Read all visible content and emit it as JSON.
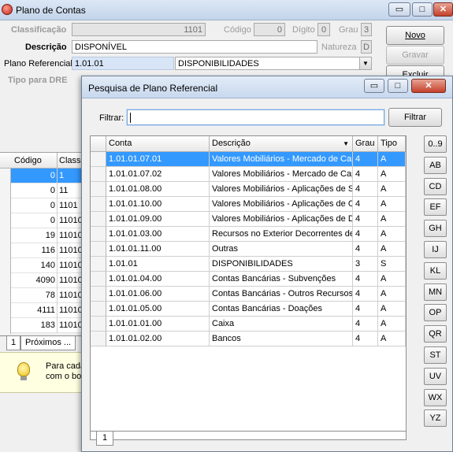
{
  "main_window": {
    "title": "Plano de Contas",
    "win_buttons": [
      "▭",
      "□",
      "✕"
    ],
    "labels": {
      "classificacao": "Classificação",
      "descricao": "Descrição",
      "plano_referencial": "Plano Referencial",
      "tipo_dre": "Tipo para DRE",
      "codigo": "Código",
      "digito": "Dígito",
      "grau": "Grau",
      "natureza": "Natureza"
    },
    "values": {
      "classificacao": "1101",
      "codigo": "0",
      "digito": "0",
      "grau": "3",
      "descricao": "DISPONÍVEL",
      "natureza": "D",
      "plano_codigo": "1.01.01",
      "plano_descricao": "DISPONIBILIDADES"
    },
    "buttons": {
      "novo": "Novo",
      "gravar": "Gravar",
      "excluir": "Excluir"
    },
    "grid": {
      "headers": [
        "Código",
        "Classif"
      ],
      "rows": [
        {
          "codigo": "0",
          "classif": "1"
        },
        {
          "codigo": "0",
          "classif": "11"
        },
        {
          "codigo": "0",
          "classif": "1101"
        },
        {
          "codigo": "0",
          "classif": "11010"
        },
        {
          "codigo": "19",
          "classif": "11010"
        },
        {
          "codigo": "116",
          "classif": "11010"
        },
        {
          "codigo": "140",
          "classif": "11010"
        },
        {
          "codigo": "4090",
          "classif": "11010"
        },
        {
          "codigo": "78",
          "classif": "11010"
        },
        {
          "codigo": "4111",
          "classif": "11010"
        },
        {
          "codigo": "183",
          "classif": "11010"
        }
      ]
    },
    "tabs": [
      "1",
      "Próximos ..."
    ],
    "hint_text": "Para cada\ncom o bo"
  },
  "dialog": {
    "title": "Pesquisa de Plano Referencial",
    "filter_label": "Filtrar:",
    "filter_value": "",
    "filter_button": "Filtrar",
    "columns": [
      "Conta",
      "Descrição",
      "Grau",
      "Tipo"
    ],
    "rows": [
      {
        "conta": "1.01.01.07.01",
        "descricao": "Valores Mobiliários - Mercado de Capitais",
        "grau": "4",
        "tipo": "A"
      },
      {
        "conta": "1.01.01.07.02",
        "descricao": "Valores Mobiliários - Mercado de Capitais",
        "grau": "4",
        "tipo": "A"
      },
      {
        "conta": "1.01.01.08.00",
        "descricao": "Valores Mobiliários - Aplicações de Subvenções",
        "grau": "4",
        "tipo": "A"
      },
      {
        "conta": "1.01.01.10.00",
        "descricao": "Valores Mobiliários - Aplicações de Outros",
        "grau": "4",
        "tipo": "A"
      },
      {
        "conta": "1.01.01.09.00",
        "descricao": "Valores Mobiliários - Aplicações de Doações",
        "grau": "4",
        "tipo": "A"
      },
      {
        "conta": "1.01.01.03.00",
        "descricao": "Recursos no Exterior Decorrentes de Exportação",
        "grau": "4",
        "tipo": "A"
      },
      {
        "conta": "1.01.01.11.00",
        "descricao": "Outras",
        "grau": "4",
        "tipo": "A"
      },
      {
        "conta": "1.01.01",
        "descricao": "DISPONIBILIDADES",
        "grau": "3",
        "tipo": "S"
      },
      {
        "conta": "1.01.01.04.00",
        "descricao": "Contas Bancárias - Subvenções",
        "grau": "4",
        "tipo": "A"
      },
      {
        "conta": "1.01.01.06.00",
        "descricao": "Contas Bancárias - Outros Recursos Sem",
        "grau": "4",
        "tipo": "A"
      },
      {
        "conta": "1.01.01.05.00",
        "descricao": "Contas Bancárias - Doações",
        "grau": "4",
        "tipo": "A"
      },
      {
        "conta": "1.01.01.01.00",
        "descricao": "Caixa",
        "grau": "4",
        "tipo": "A"
      },
      {
        "conta": "1.01.01.02.00",
        "descricao": "Bancos",
        "grau": "4",
        "tipo": "A"
      }
    ],
    "letters": [
      "0..9",
      "AB",
      "CD",
      "EF",
      "GH",
      "IJ",
      "KL",
      "MN",
      "OP",
      "QR",
      "ST",
      "UV",
      "WX",
      "YZ"
    ],
    "bottom_tab": "1"
  }
}
